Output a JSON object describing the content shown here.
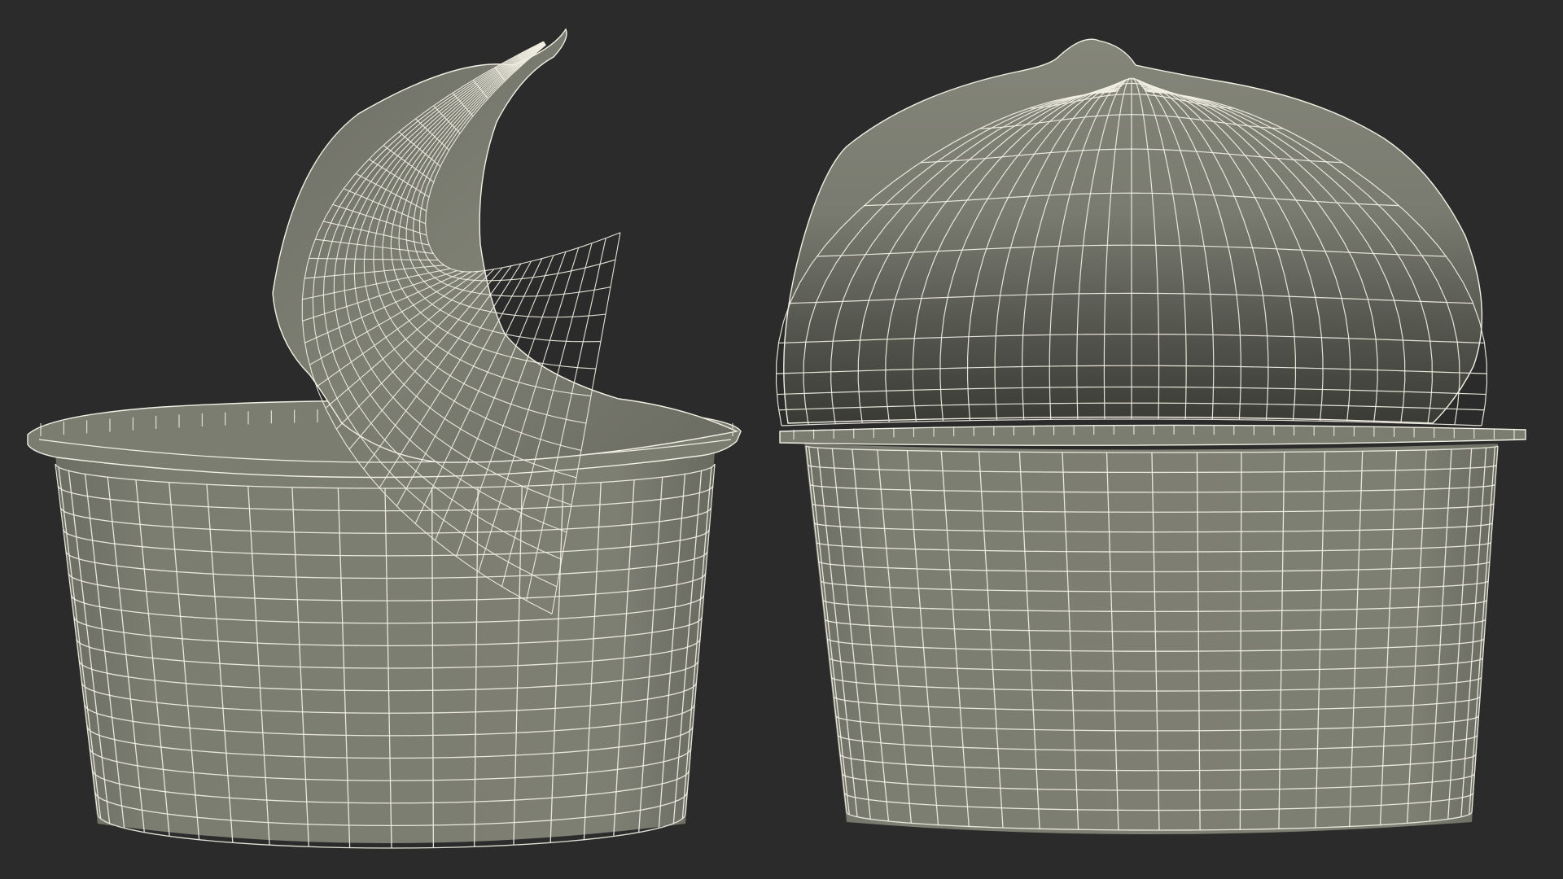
{
  "scene": {
    "background_color": "#2b2b2b",
    "model_fill_color": "#7d7e72",
    "model_shadow_color": "#4a4b44",
    "wire_color": "#f2f0e4",
    "views": [
      {
        "name": "cup-with-lid-peeled-back",
        "lid_state": "peeled"
      },
      {
        "name": "cup-with-lid-domed",
        "lid_state": "domed"
      }
    ]
  }
}
